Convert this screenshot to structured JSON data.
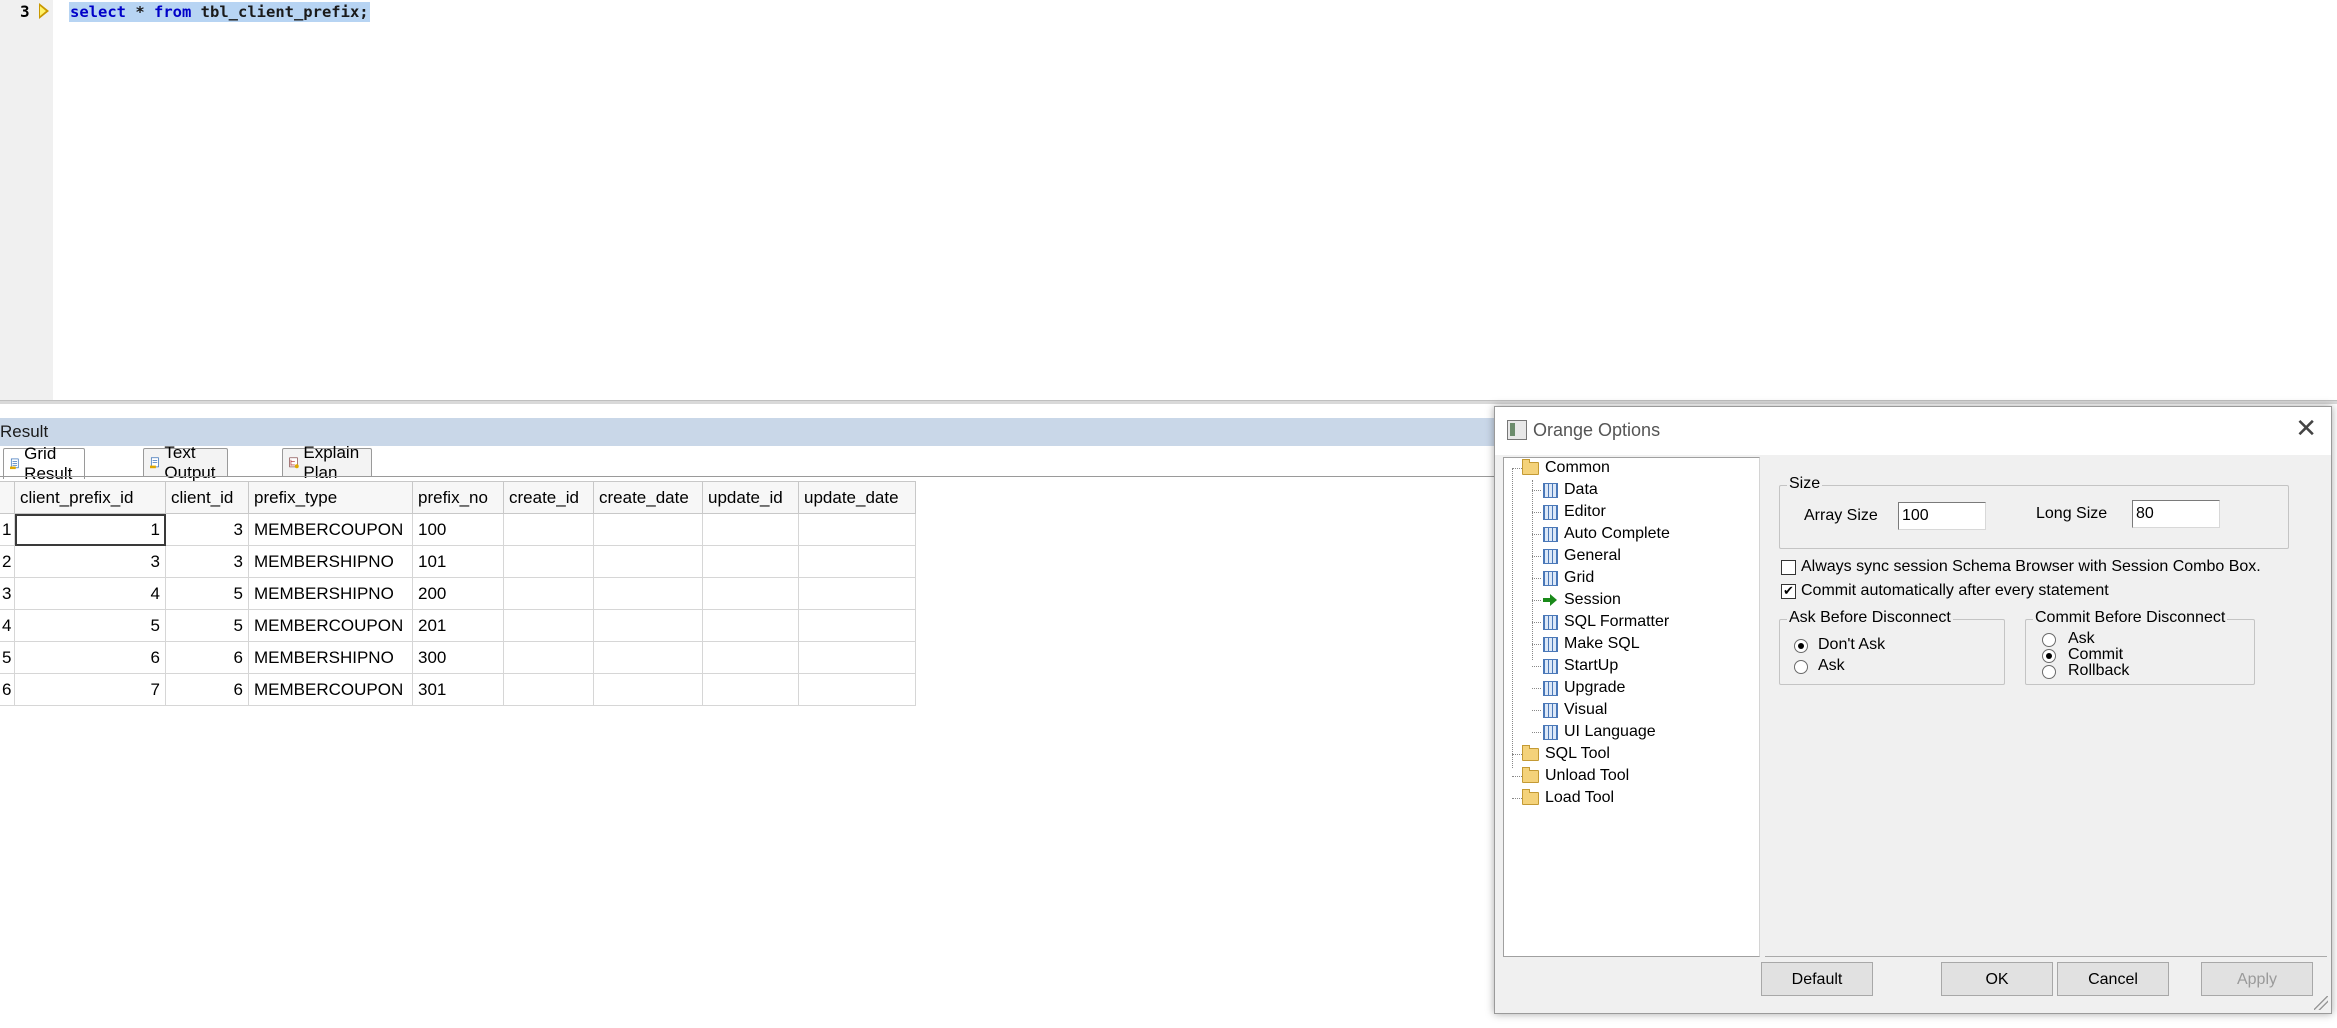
{
  "editor": {
    "line_number": "3",
    "sql": {
      "kw1": "select",
      "star": " * ",
      "kw2": "from",
      "rest": " tbl_client_prefix;"
    }
  },
  "result": {
    "title": "Result",
    "tabs": [
      {
        "label": "Grid Result",
        "icon": "grid-result-icon"
      },
      {
        "label": "Text Output",
        "icon": "text-output-icon"
      },
      {
        "label": "Explain Plan",
        "icon": "explain-plan-icon"
      }
    ],
    "grid": {
      "columns": [
        "client_prefix_id",
        "client_id",
        "prefix_type",
        "prefix_no",
        "create_id",
        "create_date",
        "update_id",
        "update_date"
      ],
      "rows": [
        [
          "1",
          "1",
          "3",
          "MEMBERCOUPON",
          "100",
          "",
          "",
          "",
          ""
        ],
        [
          "2",
          "3",
          "3",
          "MEMBERSHIPNO",
          "101",
          "",
          "",
          "",
          ""
        ],
        [
          "3",
          "4",
          "5",
          "MEMBERSHIPNO",
          "200",
          "",
          "",
          "",
          ""
        ],
        [
          "4",
          "5",
          "5",
          "MEMBERCOUPON",
          "201",
          "",
          "",
          "",
          ""
        ],
        [
          "5",
          "6",
          "6",
          "MEMBERSHIPNO",
          "300",
          "",
          "",
          "",
          ""
        ],
        [
          "6",
          "7",
          "6",
          "MEMBERCOUPON",
          "301",
          "",
          "",
          "",
          ""
        ]
      ]
    }
  },
  "dialog": {
    "title": "Orange Options",
    "close": "✕",
    "tree": {
      "common": "Common",
      "children": [
        "Data",
        "Editor",
        "Auto Complete",
        "General",
        "Grid",
        "Session",
        "SQL Formatter",
        "Make SQL",
        "StartUp",
        "Upgrade",
        "Visual",
        "UI Language"
      ],
      "selected": "Session",
      "others": [
        "SQL Tool",
        "Unload Tool",
        "Load Tool"
      ]
    },
    "size": {
      "group_title": "Size",
      "array_size_label": "Array Size",
      "array_size_value": "100",
      "long_size_label": "Long Size",
      "long_size_value": "80"
    },
    "always_sync": {
      "label": "Always sync session Schema Browser with Session Combo Box.",
      "checked": false,
      "mark": ""
    },
    "commit_auto": {
      "label": "Commit automatically after every statement",
      "checked": true,
      "mark": "✔"
    },
    "ask_before": {
      "group_title": "Ask Before Disconnect",
      "options": [
        "Don't Ask",
        "Ask"
      ],
      "selected": "Don't Ask"
    },
    "commit_before": {
      "group_title": "Commit Before Disconnect",
      "options": [
        "Ask",
        "Commit",
        "Rollback"
      ],
      "selected": "Commit"
    },
    "buttons": {
      "default": "Default",
      "ok": "OK",
      "cancel": "Cancel",
      "apply": "Apply",
      "apply_enabled": false
    }
  }
}
